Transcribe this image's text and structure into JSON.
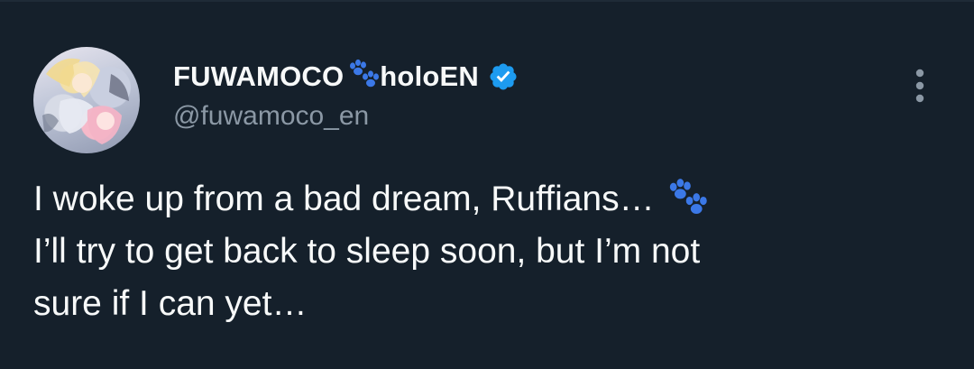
{
  "tweet": {
    "display_name_part1": "FUWAMOCO",
    "display_name_part2": "holoEN",
    "name_emoji": "paw-prints-icon",
    "verified": true,
    "handle": "@fuwamoco_en",
    "text_lines": [
      "I woke up from a bad dream, Ruffians…",
      "I’ll try to get back to sleep soon, but I’m not",
      "sure if I can yet…"
    ],
    "text_emoji": "paw-prints-icon"
  },
  "colors": {
    "background": "#15202b",
    "text_primary": "#f7f9f9",
    "text_secondary": "#8b98a5",
    "verified_blue": "#1d9bf0",
    "paw_blue": "#3b78e7"
  }
}
